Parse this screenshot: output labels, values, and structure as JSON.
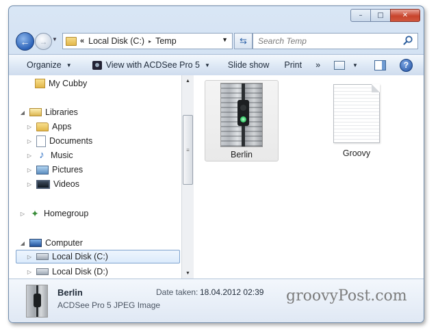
{
  "window": {
    "caption_buttons": {
      "minimize": "–",
      "maximize": "□",
      "close": "✕"
    }
  },
  "navigation": {
    "back_symbol": "←",
    "forward_symbol": "→",
    "address": {
      "overflow_symbol": "«",
      "segments": [
        "Local Disk (C:)",
        "Temp"
      ],
      "separator_symbol": "▸"
    },
    "refresh_symbol": "⇆",
    "search_placeholder": "Search Temp"
  },
  "toolbar": {
    "organize_label": "Organize",
    "view_with_label": "View with ACDSee Pro 5",
    "slideshow_label": "Slide show",
    "print_label": "Print",
    "overflow_label": "»",
    "help_label": "?"
  },
  "nav_pane": {
    "my_cubby": "My Cubby",
    "libraries": "Libraries",
    "library_items": [
      "Apps",
      "Documents",
      "Music",
      "Pictures",
      "Videos"
    ],
    "homegroup": "Homegroup",
    "computer": "Computer",
    "drives": [
      "Local Disk (C:)",
      "Local Disk (D:)"
    ],
    "selected_drive": "Local Disk (C:)"
  },
  "files": [
    {
      "name": "Berlin",
      "icon": "image-thumbnail",
      "selected": true
    },
    {
      "name": "Groovy",
      "icon": "text-document-icon",
      "selected": false
    }
  ],
  "details": {
    "name": "Berlin",
    "type": "ACDSee Pro 5 JPEG Image",
    "date_label": "Date taken:",
    "date_value": "18.04.2012 02:39"
  },
  "watermark": "groovyPost.com"
}
